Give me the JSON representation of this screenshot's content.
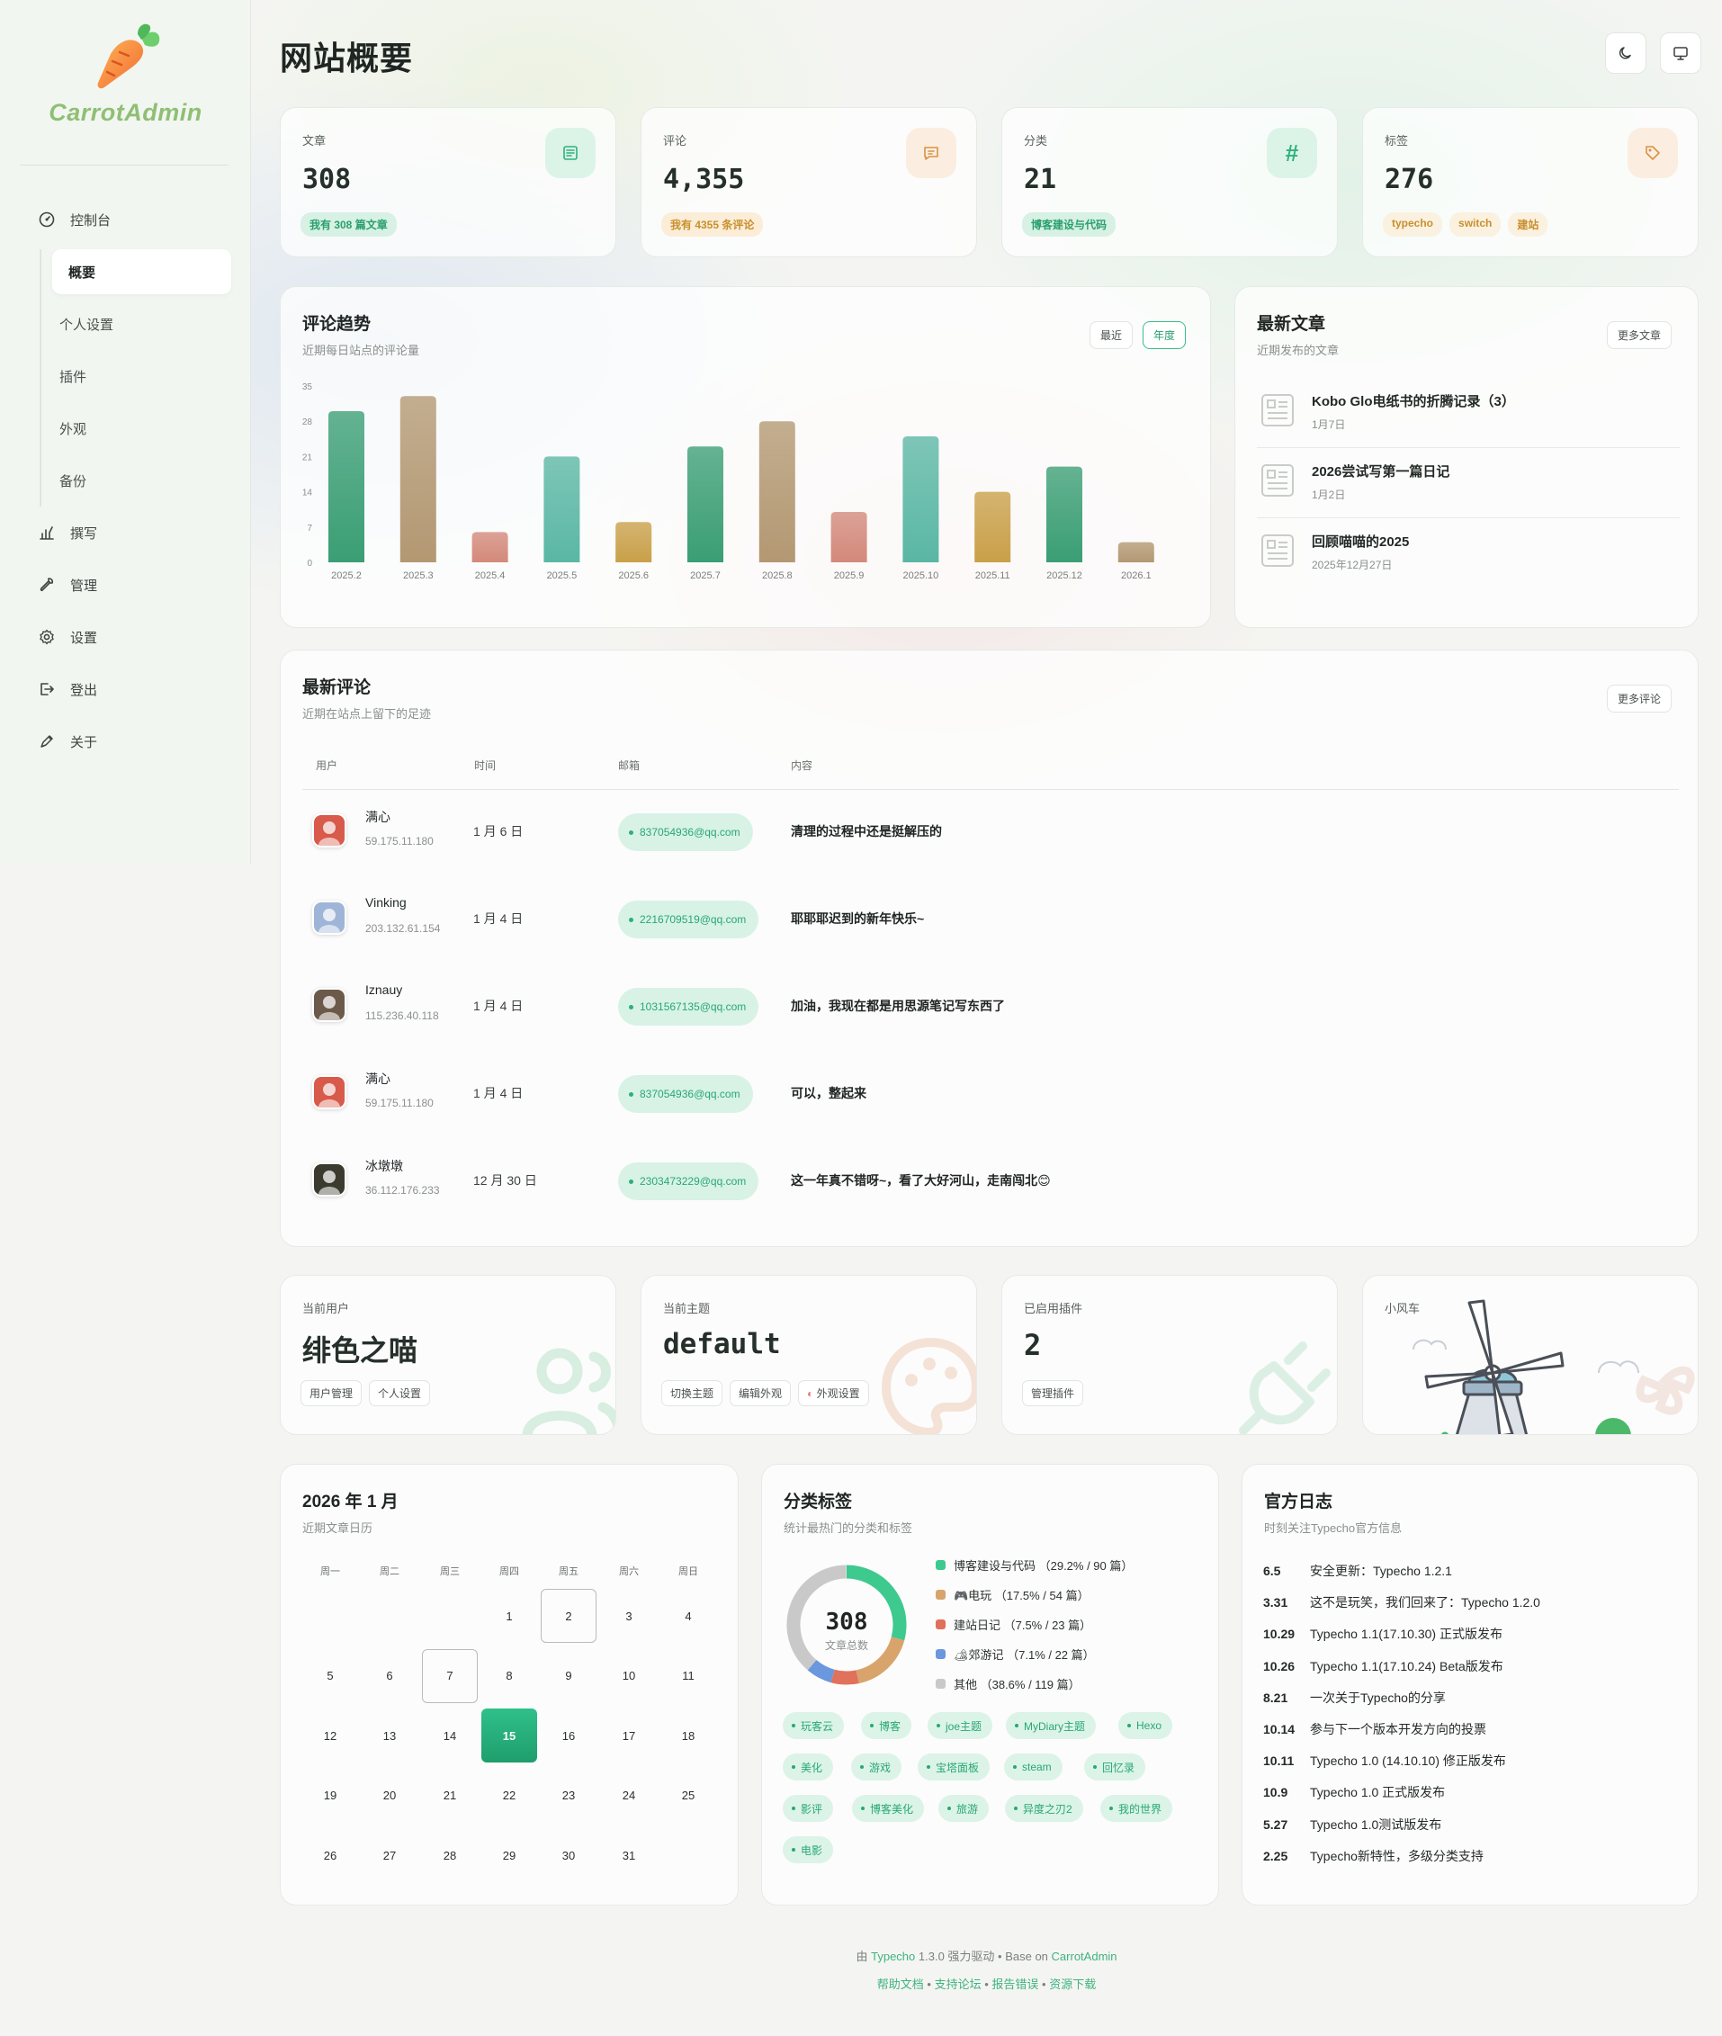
{
  "app": {
    "name": "CarrotAdmin"
  },
  "page": {
    "title": "网站概要"
  },
  "sidebar": {
    "items": [
      {
        "label": "控制台",
        "icon": "dashboard-icon"
      },
      {
        "label": "撰写",
        "icon": "write-icon"
      },
      {
        "label": "管理",
        "icon": "wrench-icon"
      },
      {
        "label": "设置",
        "icon": "gear-icon"
      },
      {
        "label": "登出",
        "icon": "logout-icon"
      },
      {
        "label": "关于",
        "icon": "pen-icon"
      }
    ],
    "subitems": [
      "概要",
      "个人设置",
      "插件",
      "外观",
      "备份"
    ],
    "active_subitem": "概要"
  },
  "stats": [
    {
      "label": "文章",
      "value": "308",
      "tags": [
        "我有 308 篇文章"
      ],
      "icon": "article-icon",
      "accent": "#3dbb8a"
    },
    {
      "label": "评论",
      "value": "4,355",
      "tags": [
        "我有 4355 条评论"
      ],
      "icon": "comment-icon",
      "accent": "#d9a24a"
    },
    {
      "label": "分类",
      "value": "21",
      "tags": [
        "博客建设与代码"
      ],
      "icon": "hash-icon",
      "accent": "#3dbb8a"
    },
    {
      "label": "标签",
      "value": "276",
      "tags": [
        "typecho",
        "switch",
        "建站"
      ],
      "icon": "tag-icon",
      "accent": "#d9a24a"
    }
  ],
  "comment_trend": {
    "title": "评论趋势",
    "subtitle": "近期每日站点的评论量",
    "buttons": [
      "最近",
      "年度"
    ],
    "active_button": "年度"
  },
  "chart_data": {
    "type": "bar",
    "categories": [
      "2025.2",
      "2025.3",
      "2025.4",
      "2025.5",
      "2025.6",
      "2025.7",
      "2025.8",
      "2025.9",
      "2025.10",
      "2025.11",
      "2025.12",
      "2026.1"
    ],
    "values": [
      30,
      33,
      6,
      21,
      8,
      23,
      28,
      10,
      25,
      14,
      19,
      4
    ],
    "yticks": [
      0,
      7,
      14,
      21,
      28,
      35
    ],
    "ylim": [
      0,
      35
    ],
    "bar_colors": [
      "#3a9e74",
      "#b39872",
      "#d3897a",
      "#5ab7a4",
      "#c9a049",
      "#3a9e74",
      "#b39872",
      "#d3897a",
      "#5ab7a4",
      "#c9a049",
      "#3a9e74",
      "#b39872"
    ],
    "title": "",
    "xlabel": "",
    "ylabel": "",
    "grid": false
  },
  "latest_posts": {
    "title": "最新文章",
    "subtitle": "近期发布的文章",
    "more": "更多文章",
    "items": [
      {
        "title": "Kobo Glo电纸书的折腾记录（3）",
        "date": "1月7日"
      },
      {
        "title": "2026尝试写第一篇日记",
        "date": "1月2日"
      },
      {
        "title": "回顾喵喵的2025",
        "date": "2025年12月27日"
      }
    ]
  },
  "latest_comments": {
    "title": "最新评论",
    "subtitle": "近期在站点上留下的足迹",
    "more": "更多评论",
    "headers": [
      "用户",
      "时间",
      "邮箱",
      "内容"
    ],
    "rows": [
      {
        "user": "满心",
        "ip": "59.175.11.180",
        "time": "1 月 6 日",
        "email": "837054936@qq.com",
        "content": "清理的过程中还是挺解压的",
        "avatar": "#d85a4a"
      },
      {
        "user": "Vinking",
        "ip": "203.132.61.154",
        "time": "1 月 4 日",
        "email": "2216709519@qq.com",
        "content": "耶耶耶迟到的新年快乐~",
        "avatar": "#9fb5d8"
      },
      {
        "user": "Iznauy",
        "ip": "115.236.40.118",
        "time": "1 月 4 日",
        "email": "1031567135@qq.com",
        "content": "加油，我现在都是用思源笔记写东西了",
        "avatar": "#6b5a4a"
      },
      {
        "user": "满心",
        "ip": "59.175.11.180",
        "time": "1 月 4 日",
        "email": "837054936@qq.com",
        "content": "可以，整起来",
        "avatar": "#d85a4a"
      },
      {
        "user": "冰墩墩",
        "ip": "36.112.176.233",
        "time": "12 月 30 日",
        "email": "2303473229@qq.com",
        "content": "这一年真不错呀~，看了大好河山，走南闯北😊",
        "avatar": "#3b3a2e"
      }
    ]
  },
  "current_user": {
    "label": "当前用户",
    "value": "绯色之喵",
    "buttons": [
      "用户管理",
      "个人设置"
    ]
  },
  "current_theme": {
    "label": "当前主题",
    "value": "default",
    "buttons": [
      "切换主题",
      "编辑外观",
      "外观设置"
    ]
  },
  "plugins": {
    "label": "已启用插件",
    "value": "2",
    "buttons": [
      "管理插件"
    ]
  },
  "windmill": {
    "label": "小风车"
  },
  "calendar": {
    "title": "2026 年 1 月",
    "subtitle": "近期文章日历",
    "weekdays": [
      "周一",
      "周二",
      "周三",
      "周四",
      "周五",
      "周六",
      "周日"
    ],
    "first_weekday_index": 3,
    "days_in_month": 31,
    "today": 15,
    "post_days": [
      2,
      7
    ]
  },
  "categories": {
    "title": "分类标签",
    "subtitle": "统计最热门的分类和标签",
    "total": "308",
    "total_label": "文章总数",
    "legend": [
      {
        "label": "博客建设与代码 （29.2% / 90 篇）",
        "color": "#3ec98e",
        "percent": 29.2
      },
      {
        "label": "🎮电玩 （17.5% / 54 篇）",
        "color": "#d9a36c",
        "percent": 17.5
      },
      {
        "label": "建站日记 （7.5% / 23 篇）",
        "color": "#e0715a",
        "percent": 7.5
      },
      {
        "label": "🏕郊游记 （7.1% / 22 篇）",
        "color": "#6a97dd",
        "percent": 7.1
      },
      {
        "label": "其他 （38.6% / 119 篇）",
        "color": "#c9c9c9",
        "percent": 38.6
      }
    ],
    "tags": [
      "玩客云",
      "博客",
      "joe主题",
      "MyDiary主题",
      "Hexo",
      "美化",
      "游戏",
      "宝塔面板",
      "steam",
      "回忆录",
      "影评",
      "博客美化",
      "旅游",
      "异度之刃2",
      "我的世界",
      "电影"
    ]
  },
  "official_log": {
    "title": "官方日志",
    "subtitle": "时刻关注Typecho官方信息",
    "items": [
      {
        "date": "6.5",
        "text": "安全更新：Typecho 1.2.1"
      },
      {
        "date": "3.31",
        "text": "这不是玩笑，我们回来了：Typecho 1.2.0"
      },
      {
        "date": "10.29",
        "text": "Typecho 1.1(17.10.30) 正式版发布"
      },
      {
        "date": "10.26",
        "text": "Typecho 1.1(17.10.24) Beta版发布"
      },
      {
        "date": "8.21",
        "text": "一次关于Typecho的分享"
      },
      {
        "date": "10.14",
        "text": "参与下一个版本开发方向的投票"
      },
      {
        "date": "10.11",
        "text": "Typecho 1.0 (14.10.10) 修正版发布"
      },
      {
        "date": "10.9",
        "text": "Typecho 1.0 正式版发布"
      },
      {
        "date": "5.27",
        "text": "Typecho 1.0测试版发布"
      },
      {
        "date": "2.25",
        "text": "Typecho新特性，多级分类支持"
      }
    ]
  },
  "footer": {
    "prefix": "由",
    "typecho": "Typecho",
    "version_text": "1.3.0 强力驱动 • Base on",
    "carrot": "CarrotAdmin",
    "links": [
      "帮助文档",
      "支持论坛",
      "报告错误",
      "资源下载"
    ],
    "sep": "•"
  }
}
